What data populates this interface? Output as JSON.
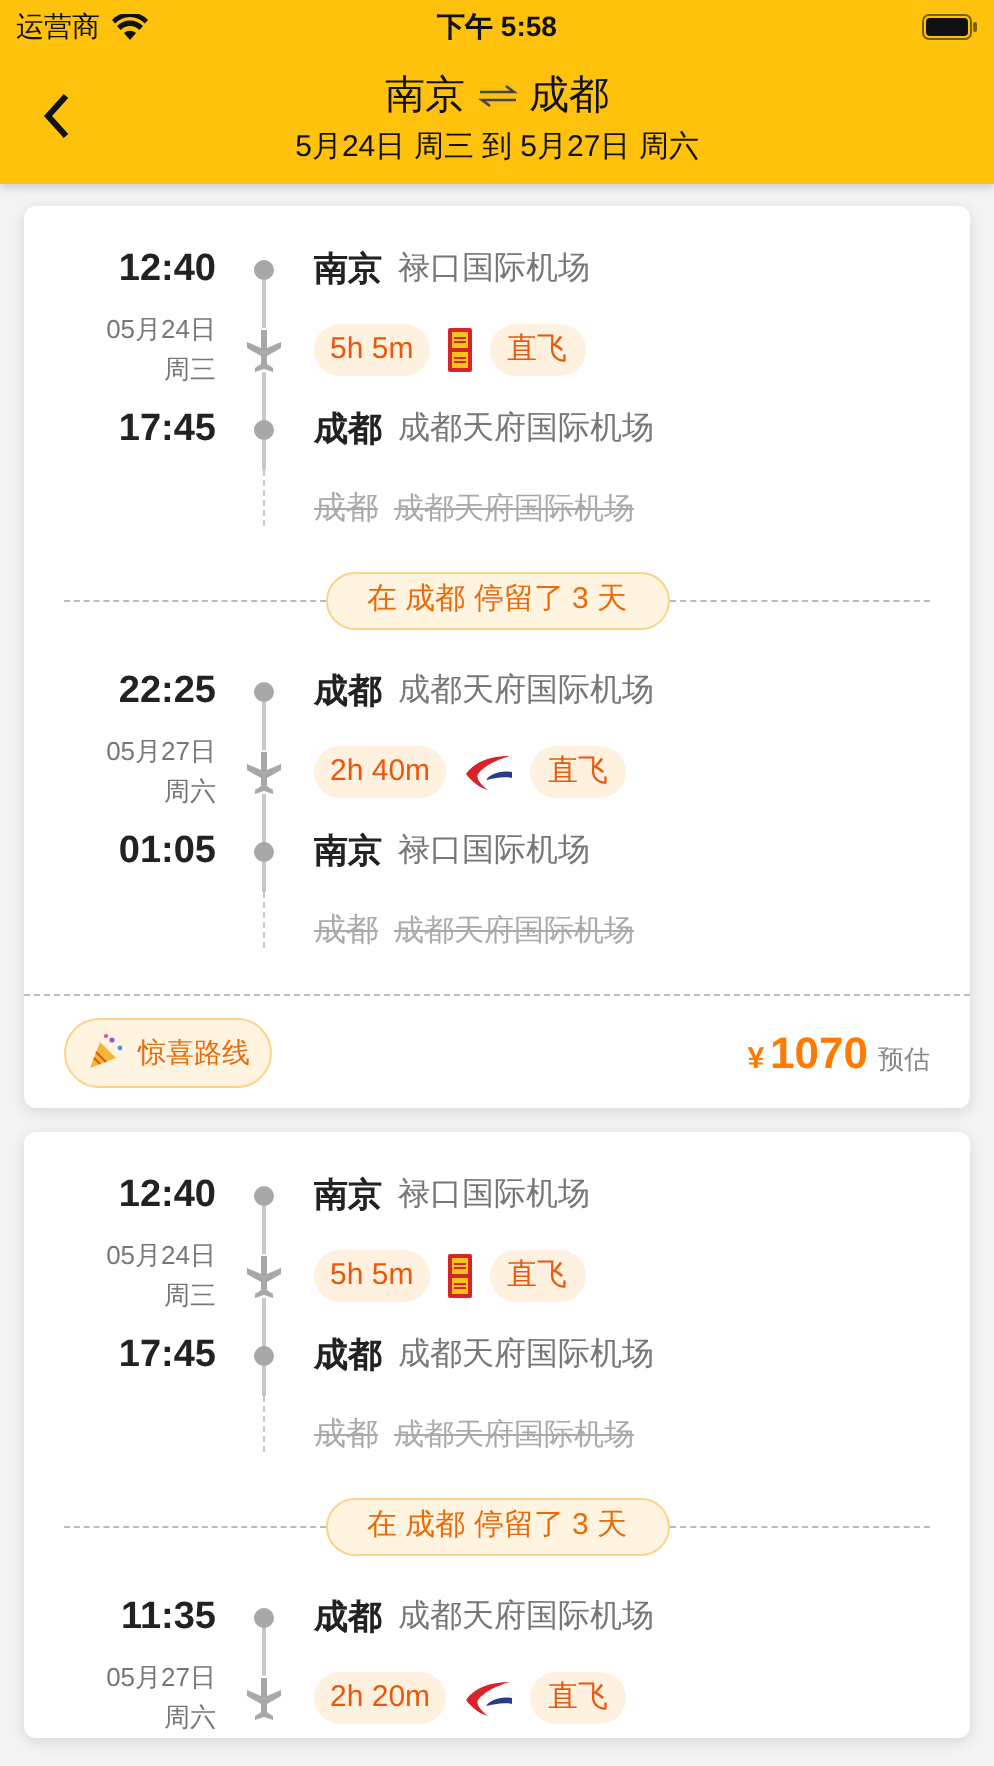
{
  "status_bar": {
    "carrier": "运营商",
    "time": "下午 5:58"
  },
  "header": {
    "from": "南京",
    "to": "成都",
    "subtitle": "5月24日 周三 到 5月27日 周六"
  },
  "itineraries": [
    {
      "legs": [
        {
          "depart": {
            "time": "12:40",
            "city": "南京",
            "airport": "禄口国际机场"
          },
          "date": "05月24日",
          "weekday": "周三",
          "duration": "5h 5m",
          "airline_logo": {
            "kind": "seal"
          },
          "tag": "直飞",
          "arrive": {
            "time": "17:45",
            "city": "成都",
            "airport": "成都天府国际机场"
          },
          "ghost": {
            "city": "成都",
            "airport": "成都天府国际机场",
            "struck": true
          }
        },
        {
          "depart": {
            "time": "22:25",
            "city": "成都",
            "airport": "成都天府国际机场"
          },
          "date": "05月27日",
          "weekday": "周六",
          "duration": "2h 40m",
          "airline_logo": {
            "kind": "swallow"
          },
          "tag": "直飞",
          "arrive": {
            "time": "01:05",
            "city": "南京",
            "airport": "禄口国际机场"
          },
          "ghost": {
            "city": "成都",
            "airport": "成都天府国际机场",
            "struck": true
          }
        }
      ],
      "stay": "在 成都 停留了 3 天",
      "badge": "惊喜路线",
      "currency": "¥",
      "price": "1070",
      "price_note": "预估"
    },
    {
      "legs": [
        {
          "depart": {
            "time": "12:40",
            "city": "南京",
            "airport": "禄口国际机场"
          },
          "date": "05月24日",
          "weekday": "周三",
          "duration": "5h 5m",
          "airline_logo": {
            "kind": "seal"
          },
          "tag": "直飞",
          "arrive": {
            "time": "17:45",
            "city": "成都",
            "airport": "成都天府国际机场"
          },
          "ghost": {
            "city": "成都",
            "airport": "成都天府国际机场",
            "struck": true
          }
        },
        {
          "depart": {
            "time": "11:35",
            "city": "成都",
            "airport": "成都天府国际机场"
          },
          "date": "05月27日",
          "weekday": "周六",
          "duration": "2h 20m",
          "airline_logo": {
            "kind": "swallow"
          },
          "tag": "直飞"
        }
      ],
      "stay": "在 成都 停留了 3 天"
    }
  ]
}
